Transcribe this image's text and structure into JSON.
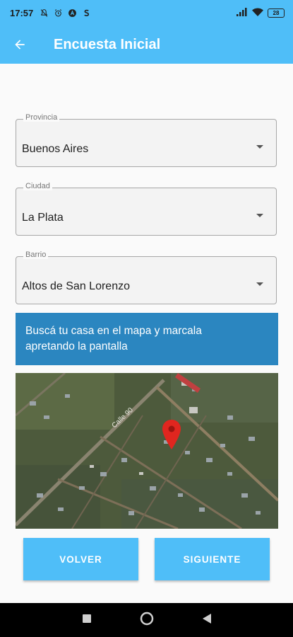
{
  "status_bar": {
    "time": "17:57",
    "battery": "28"
  },
  "app_bar": {
    "title": "Encuesta Inicial"
  },
  "fields": {
    "provincia": {
      "label": "Provincia",
      "value": "Buenos Aires"
    },
    "ciudad": {
      "label": "Ciudad",
      "value": "La Plata"
    },
    "barrio": {
      "label": "Barrio",
      "value": "Altos de San Lorenzo"
    }
  },
  "banner": {
    "text_line1": "Buscá tu casa en el mapa y marcala",
    "text_line2": "apretando la pantalla"
  },
  "map": {
    "street_label": "Calle 90",
    "marker_color": "#e0261f"
  },
  "buttons": {
    "back": "VOLVER",
    "next": "SIGUIENTE"
  },
  "colors": {
    "primary": "#4fbef8",
    "banner": "#2b86c0"
  }
}
